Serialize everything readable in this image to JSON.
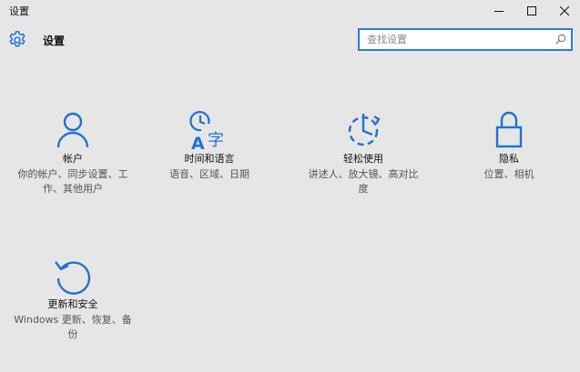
{
  "window": {
    "title": "设置"
  },
  "header": {
    "title": "设置",
    "icon": "gear-icon"
  },
  "search": {
    "placeholder": "查找设置",
    "value": ""
  },
  "colors": {
    "accent": "#1e73cf",
    "background": "#e6e6e6",
    "search_border": "#2b7bd6"
  },
  "tiles": [
    {
      "icon": "person-icon",
      "title": "帐户",
      "description": "你的帐户、同步设置、工作、其他用户"
    },
    {
      "icon": "time-language-icon",
      "title": "时间和语言",
      "description": "语音、区域、日期"
    },
    {
      "icon": "ease-of-access-icon",
      "title": "轻松使用",
      "description": "讲述人、放大镜、高对比度"
    },
    {
      "icon": "lock-icon",
      "title": "隐私",
      "description": "位置、相机"
    },
    {
      "icon": "update-refresh-icon",
      "title": "更新和安全",
      "description": "Windows 更新、恢复、备份"
    }
  ]
}
